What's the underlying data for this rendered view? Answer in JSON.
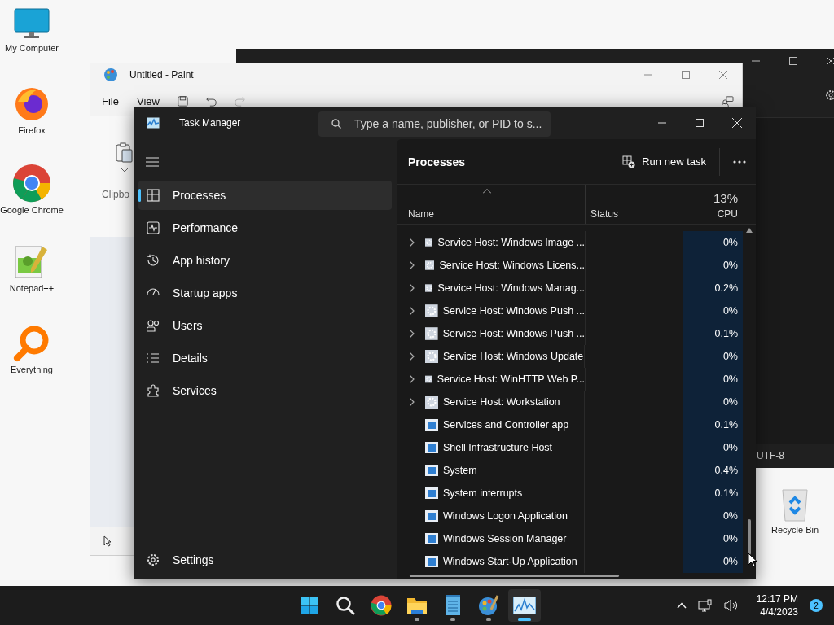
{
  "desktop": {
    "icons": [
      {
        "label": "My Computer"
      },
      {
        "label": "Firefox"
      },
      {
        "label": "Google Chrome"
      },
      {
        "label": "Notepad++"
      },
      {
        "label": "Everything"
      }
    ],
    "recycle_bin": {
      "label": "Recycle Bin"
    }
  },
  "background_window": {
    "status_text": "UTF-8"
  },
  "paint": {
    "title": "Untitled - Paint",
    "menu": [
      "File",
      "View"
    ],
    "ribbon_group": "Clipbo"
  },
  "task_manager": {
    "title": "Task Manager",
    "search": {
      "placeholder": "Type a name, publisher, or PID to s..."
    },
    "nav": [
      {
        "label": "Processes",
        "selected": true
      },
      {
        "label": "Performance",
        "selected": false
      },
      {
        "label": "App history",
        "selected": false
      },
      {
        "label": "Startup apps",
        "selected": false
      },
      {
        "label": "Users",
        "selected": false
      },
      {
        "label": "Details",
        "selected": false
      },
      {
        "label": "Services",
        "selected": false
      }
    ],
    "settings": "Settings",
    "page_title": "Processes",
    "run_task": "Run new task",
    "columns": {
      "name": "Name",
      "status": "Status",
      "cpu_total": "13%",
      "cpu": "CPU"
    },
    "rows": [
      {
        "kind": "service",
        "name": "Service Host: Windows Image ...",
        "cpu": "0%"
      },
      {
        "kind": "service",
        "name": "Service Host: Windows Licens...",
        "cpu": "0%"
      },
      {
        "kind": "service",
        "name": "Service Host: Windows Manag...",
        "cpu": "0.2%"
      },
      {
        "kind": "service",
        "name": "Service Host: Windows Push ...",
        "cpu": "0%"
      },
      {
        "kind": "service",
        "name": "Service Host: Windows Push ...",
        "cpu": "0.1%"
      },
      {
        "kind": "service",
        "name": "Service Host: Windows Update",
        "cpu": "0%"
      },
      {
        "kind": "service",
        "name": "Service Host: WinHTTP Web P...",
        "cpu": "0%"
      },
      {
        "kind": "service",
        "name": "Service Host: Workstation",
        "cpu": "0%"
      },
      {
        "kind": "app",
        "name": "Services and Controller app",
        "cpu": "0.1%"
      },
      {
        "kind": "app",
        "name": "Shell Infrastructure Host",
        "cpu": "0%"
      },
      {
        "kind": "app",
        "name": "System",
        "cpu": "0.4%"
      },
      {
        "kind": "app",
        "name": "System interrupts",
        "cpu": "0.1%"
      },
      {
        "kind": "app",
        "name": "Windows Logon Application",
        "cpu": "0%"
      },
      {
        "kind": "app",
        "name": "Windows Session Manager",
        "cpu": "0%"
      },
      {
        "kind": "app",
        "name": "Windows Start-Up Application",
        "cpu": "0%"
      }
    ]
  },
  "taskbar": {
    "apps": [
      {
        "running": false,
        "selected": false
      },
      {
        "running": true,
        "selected": false
      },
      {
        "running": true,
        "selected": false
      },
      {
        "running": true,
        "selected": false
      },
      {
        "running": true,
        "selected": true
      }
    ],
    "clock": {
      "time": "12:17 PM",
      "date": "4/4/2023"
    },
    "notifications": "2"
  }
}
